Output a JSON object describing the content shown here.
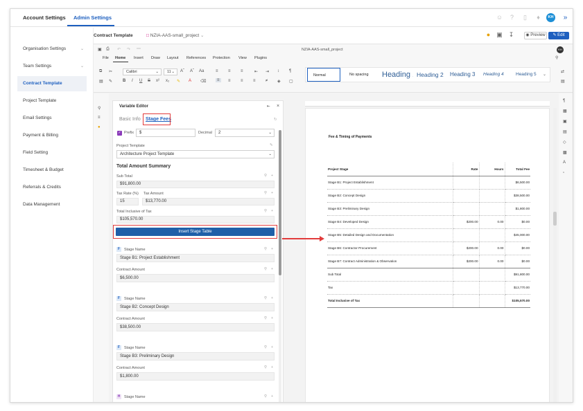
{
  "top_nav": {
    "account_settings": "Account Settings",
    "admin_settings": "Admin Settings",
    "avatar_initials": "KH"
  },
  "sidebar": {
    "items": [
      {
        "label": "Organisation Settings",
        "chevron": true
      },
      {
        "label": "Team Settings",
        "chevron": true
      },
      {
        "label": "Contract Template",
        "active": true
      },
      {
        "label": "Project Template"
      },
      {
        "label": "Email Settings"
      },
      {
        "label": "Payment & Billing"
      },
      {
        "label": "Field Setting"
      },
      {
        "label": "Timesheet & Budget"
      },
      {
        "label": "Referrals & Credits"
      },
      {
        "label": "Data Management"
      }
    ]
  },
  "header": {
    "title": "Contract Template",
    "doc_tab": "NZIA-AAS-small_project",
    "preview": "Preview",
    "edit": "Edit"
  },
  "editor": {
    "doc_name": "NZIA-AAS-small_project",
    "menus": [
      "File",
      "Home",
      "Insert",
      "Draw",
      "Layout",
      "References",
      "Protection",
      "View",
      "Plugins"
    ],
    "font": "Calibri",
    "font_size": "11",
    "styles": [
      "Normal",
      "No spacing",
      "Heading 1",
      "Heading 2",
      "Heading 3",
      "Heading 4",
      "Heading 5"
    ]
  },
  "variable_editor": {
    "title": "Variable Editor",
    "tab_basic": "Basic Info",
    "tab_stage": "Stage Fees",
    "prefix_label": "Prefix",
    "prefix_value": "$",
    "decimal_label": "Decimal",
    "decimal_value": "2",
    "project_template_label": "Project Template",
    "project_template_value": "Architecture Project Template",
    "total_heading": "Total Amount Summary",
    "sub_total_label": "Sub Total",
    "sub_total_value": "$91,800.00",
    "tax_rate_label": "Tax Rate (%)",
    "tax_rate_value": "15",
    "tax_amount_label": "Tax Amount",
    "tax_amount_value": "$13,770.00",
    "total_incl_label": "Total Inclusive of Tax",
    "total_incl_value": "$105,570.00",
    "insert_button": "Insert Stage Table",
    "stage_name_label": "Stage Name",
    "contract_amount_label": "Contract Amount",
    "stages": [
      {
        "badge": "F",
        "name": "Stage B1: Project Establishment",
        "amount": "$6,500.00"
      },
      {
        "badge": "F",
        "name": "Stage B2: Concept Design",
        "amount": "$38,500.00"
      },
      {
        "badge": "F",
        "name": "Stage B3: Preliminary Design",
        "amount": "$1,800.00"
      },
      {
        "badge": "H",
        "name": "",
        "amount": ""
      }
    ]
  },
  "document": {
    "heading": "Fee & Timing of Payments",
    "columns": [
      "Project Stage",
      "Rate",
      "Hours",
      "Total Fee"
    ],
    "rows": [
      [
        "Stage B1: Project Establishment",
        "",
        "",
        "$6,500.00"
      ],
      [
        "Stage B2: Concept Design",
        "",
        "",
        "$38,500.00"
      ],
      [
        "Stage B3: Preliminary Design",
        "",
        "",
        "$1,800.00"
      ],
      [
        "Stage B4: Developed Design",
        "$200.00",
        "0.00",
        "$0.00"
      ],
      [
        "Stage B5: Detailed Design and Documentation",
        "",
        "",
        "$45,000.00"
      ],
      [
        "Stage B6: Contractor Procurement",
        "$200.00",
        "0.00",
        "$0.00"
      ],
      [
        "Stage B7: Contract Administration & Observation",
        "$200.00",
        "0.00",
        "$0.00"
      ],
      [
        "Sub Total",
        "",
        "",
        "$91,800.00"
      ],
      [
        "Tax",
        "",
        "",
        "$13,770.00"
      ],
      [
        "Total Inclusive of Tax",
        "",
        "",
        "$105,570.00"
      ]
    ]
  }
}
